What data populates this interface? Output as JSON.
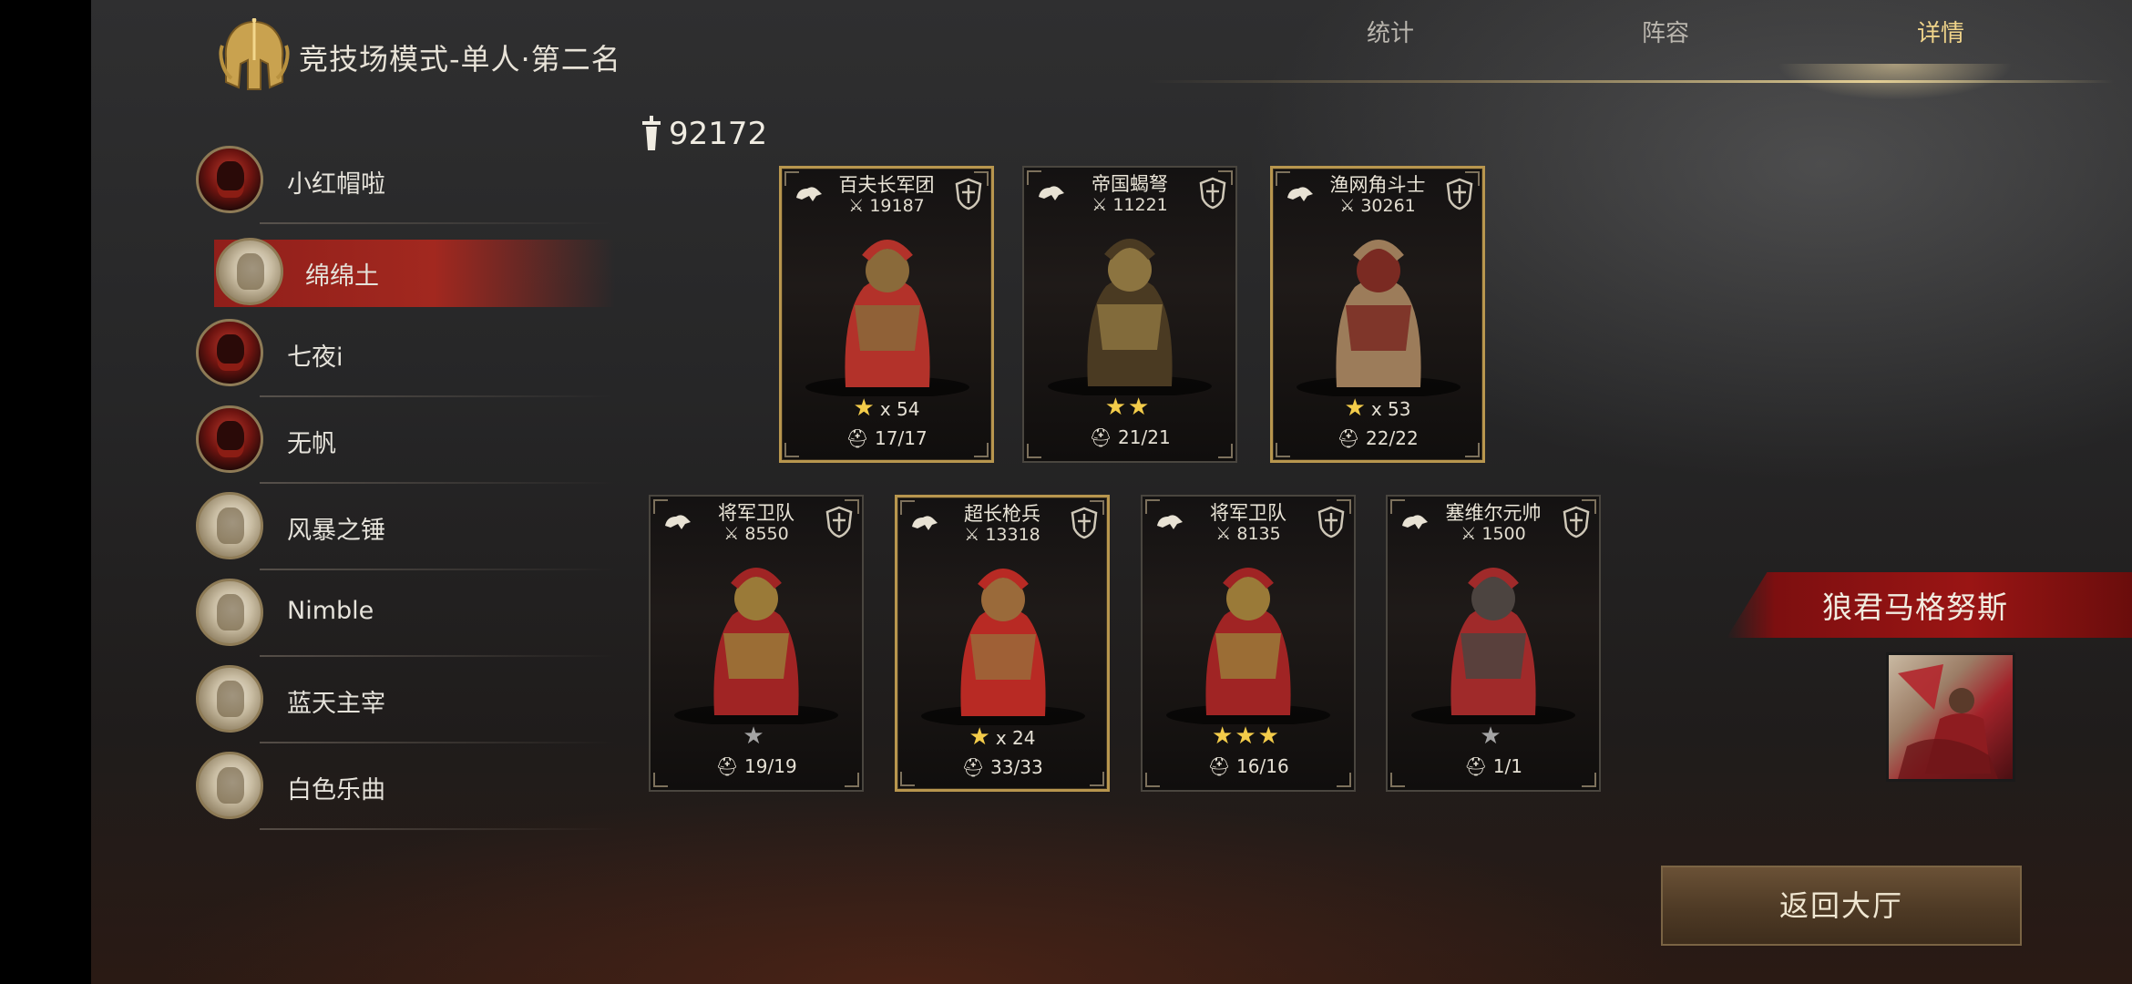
{
  "header": {
    "title": "竞技场模式-单人·第二名",
    "tabs": [
      {
        "label": "统计",
        "active": false
      },
      {
        "label": "阵容",
        "active": false
      },
      {
        "label": "详情",
        "active": true
      }
    ]
  },
  "total_power": "92172",
  "players": [
    {
      "name": "小红帽啦",
      "avatar": "red-demon-avatar",
      "selected": false
    },
    {
      "name": "绵绵土",
      "avatar": "knight-avatar",
      "selected": true
    },
    {
      "name": "七夜i",
      "avatar": "red-demon-avatar",
      "selected": false
    },
    {
      "name": "无帆",
      "avatar": "red-demon-avatar",
      "selected": false
    },
    {
      "name": "风暴之锤",
      "avatar": "knight-avatar",
      "selected": false
    },
    {
      "name": "Nimble",
      "avatar": "knight-avatar",
      "selected": false
    },
    {
      "name": "蓝天主宰",
      "avatar": "knight-avatar",
      "selected": false
    },
    {
      "name": "白色乐曲",
      "avatar": "knight-avatar",
      "selected": false
    }
  ],
  "units": [
    {
      "name": "百夫长军团",
      "power": "19187",
      "stars_gold": 1,
      "stars_grey": 0,
      "multiplier": "x 54",
      "troops": "17/17",
      "class_icon": "shield-cross-icon",
      "frame": "gold"
    },
    {
      "name": "帝国蝎弩",
      "power": "11221",
      "stars_gold": 2,
      "stars_grey": 0,
      "multiplier": "",
      "troops": "21/21",
      "class_icon": "crossbow-icon",
      "frame": "plain"
    },
    {
      "name": "渔网角斗士",
      "power": "30261",
      "stars_gold": 1,
      "stars_grey": 0,
      "multiplier": "x 53",
      "troops": "22/22",
      "class_icon": "shield-cross-icon",
      "frame": "gold"
    },
    {
      "name": "将军卫队",
      "power": "8550",
      "stars_gold": 0,
      "stars_grey": 1,
      "multiplier": "",
      "troops": "19/19",
      "class_icon": "horse-head-icon",
      "frame": "plain"
    },
    {
      "name": "超长枪兵",
      "power": "13318",
      "stars_gold": 1,
      "stars_grey": 0,
      "multiplier": "x 24",
      "troops": "33/33",
      "class_icon": "shield-cross-icon",
      "frame": "gold"
    },
    {
      "name": "将军卫队",
      "power": "8135",
      "stars_gold": 3,
      "stars_grey": 0,
      "multiplier": "",
      "troops": "16/16",
      "class_icon": "horse-head-icon",
      "frame": "plain"
    },
    {
      "name": "塞维尔元帅",
      "power": "1500",
      "stars_gold": 0,
      "stars_grey": 1,
      "multiplier": "",
      "troops": "1/1",
      "class_icon": "helmet-crest-icon",
      "frame": "plain"
    }
  ],
  "hero": {
    "name": "狼君马格努斯"
  },
  "buttons": {
    "return_label": "返回大厅"
  },
  "colors": {
    "accent_gold": "#f0d48a",
    "selected_red": "#a8261c",
    "star_gold": "#f3cc4a"
  }
}
